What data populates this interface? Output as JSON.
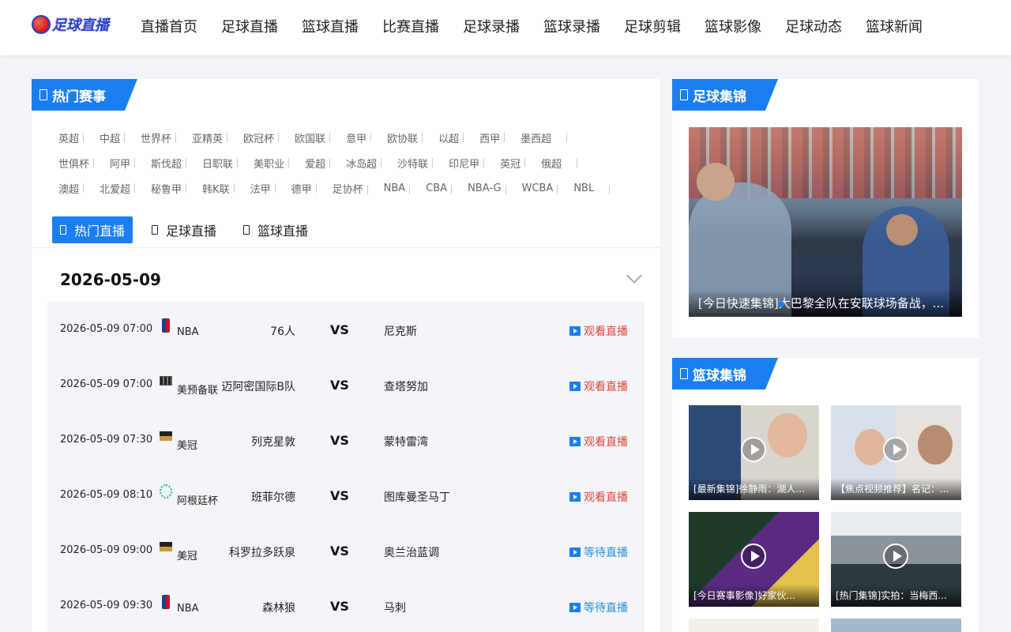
{
  "brand": {
    "logo_text": "足球直播"
  },
  "nav": [
    "直播首页",
    "足球直播",
    "篮球直播",
    "比赛直播",
    "足球录播",
    "篮球录播",
    "足球剪辑",
    "篮球影像",
    "足球动态",
    "篮球新闻"
  ],
  "hot_events": {
    "title": "热门赛事",
    "rows": [
      [
        "英超",
        "中超",
        "世界杯",
        "亚精英",
        "欧冠杯",
        "欧国联",
        "意甲",
        "欧协联",
        "以超",
        "西甲",
        "墨西超"
      ],
      [
        "世俱杯",
        "阿甲",
        "斯伐超",
        "日职联",
        "美职业",
        "爱超",
        "冰岛超",
        "沙特联",
        "印尼甲",
        "英冠",
        "俄超"
      ],
      [
        "澳超",
        "北爱超",
        "秘鲁甲",
        "韩K联",
        "法甲",
        "德甲",
        "足协杯",
        "NBA",
        "CBA",
        "NBA-G",
        "WCBA",
        "NBL"
      ]
    ]
  },
  "live_tabs": [
    "热门直播",
    "足球直播",
    "篮球直播"
  ],
  "date": "2026-05-09",
  "matches": [
    {
      "time": "2026-05-09 07:00",
      "league": "NBA",
      "icon": "nba-icon",
      "home": "76人",
      "vs": "VS",
      "away": "尼克斯",
      "action": "观看直播",
      "action_color": "#e0463a"
    },
    {
      "time": "2026-05-09 07:00",
      "league": "美预备联",
      "icon": "league-flag-icon",
      "home": "迈阿密国际B队",
      "vs": "VS",
      "away": "查塔努加",
      "action": "观看直播",
      "action_color": "#e0463a"
    },
    {
      "time": "2026-05-09 07:30",
      "league": "美冠",
      "icon": "usl-badge-icon",
      "home": "列克星敦",
      "vs": "VS",
      "away": "蒙特雷湾",
      "action": "观看直播",
      "action_color": "#e0463a"
    },
    {
      "time": "2026-05-09 08:10",
      "league": "阿根廷杯",
      "icon": "argentina-cup-icon",
      "home": "班菲尔德",
      "vs": "VS",
      "away": "图库曼圣马丁",
      "action": "观看直播",
      "action_color": "#e0463a"
    },
    {
      "time": "2026-05-09 09:00",
      "league": "美冠",
      "icon": "usl-badge-icon",
      "home": "科罗拉多跃泉",
      "vs": "VS",
      "away": "奥兰治蓝调",
      "action": "等待直播",
      "action_color": "#2a8fd4"
    },
    {
      "time": "2026-05-09 09:30",
      "league": "NBA",
      "icon": "nba-icon",
      "home": "森林狼",
      "vs": "VS",
      "away": "马刺",
      "action": "等待直播",
      "action_color": "#2a8fd4"
    }
  ],
  "football_highlights": {
    "title": "足球集锦",
    "feature_caption": "[今日快速集锦]大巴黎全队在安联球场备战，..."
  },
  "basketball_highlights": {
    "title": "篮球集锦",
    "items": [
      {
        "caption": "[最新集锦]徐静雨：湖人..."
      },
      {
        "caption": "【焦点视频推荐】名记：..."
      },
      {
        "caption": "[今日赛事影像]好家伙..."
      },
      {
        "caption": "[热门集锦]实拍：当梅西..."
      }
    ]
  },
  "colors": {
    "accent": "#1a7ef0",
    "watch": "#e0463a",
    "wait": "#2a8fd4"
  }
}
